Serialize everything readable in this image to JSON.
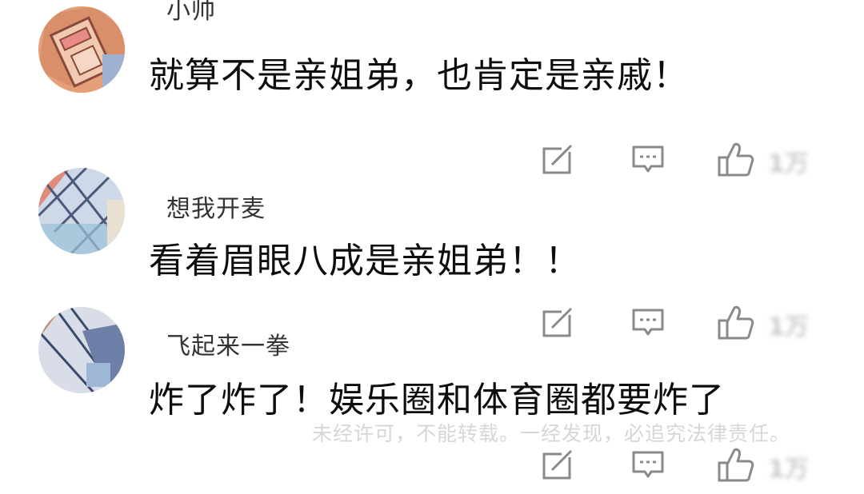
{
  "comments": [
    {
      "username": "小帅",
      "text": "就算不是亲姐弟，也肯定是亲戚！",
      "like_count": "1万",
      "avatar_color": "#e6a079"
    },
    {
      "username": "想我开麦",
      "text": "看着眉眼八成是亲姐弟！！",
      "like_count": "1万",
      "avatar_color": "#8aa7c9"
    },
    {
      "username": "飞起来一拳",
      "text": "炸了炸了！娱乐圈和体育圈都要炸了",
      "like_count": "1万",
      "avatar_color": "#6d7fa6"
    }
  ],
  "actions": {
    "share_icon": "share-icon",
    "reply_icon": "reply-icon",
    "like_icon": "thumbs-up-icon"
  },
  "watermark": "未经许可，不能转载。一经发现，必追究法律责任。",
  "colors": {
    "icon": "#8a8a8a",
    "text": "#0d0d0d",
    "username": "#333333"
  }
}
